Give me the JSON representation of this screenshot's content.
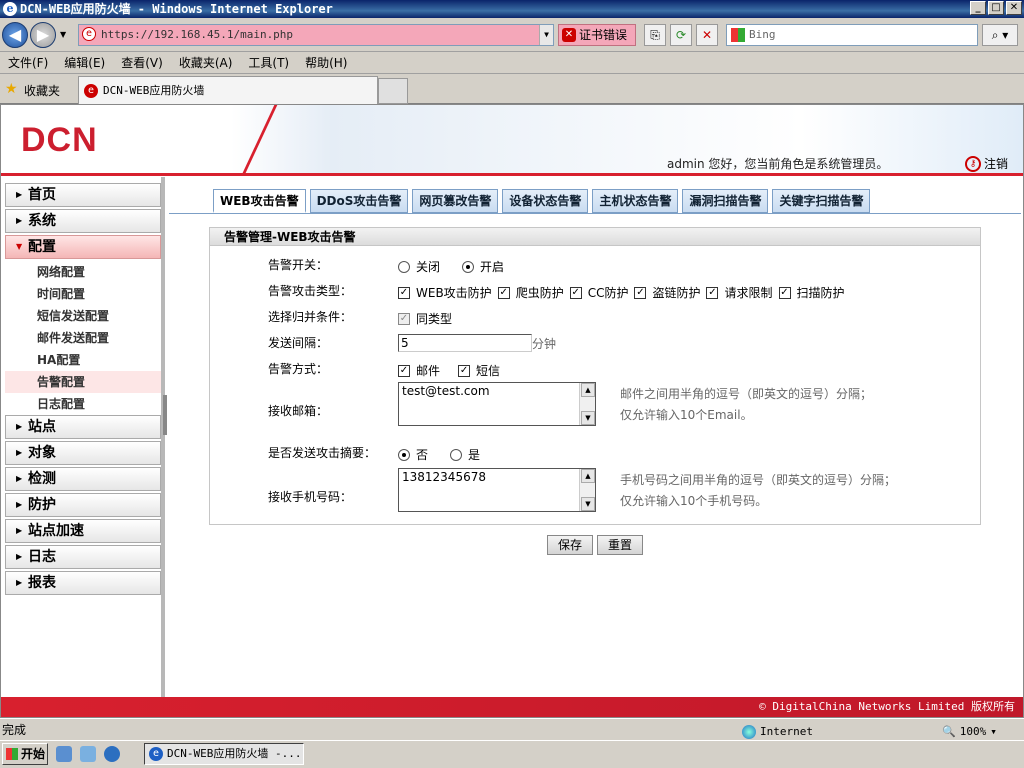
{
  "window": {
    "title": "DCN-WEB应用防火墙 - Windows Internet Explorer",
    "min": "_",
    "max": "□",
    "close": "✕"
  },
  "address": {
    "url": "https://192.168.45.1/main.php",
    "cert_error": "证书错误",
    "search_placeholder": "Bing"
  },
  "menu": [
    "文件(F)",
    "编辑(E)",
    "查看(V)",
    "收藏夹(A)",
    "工具(T)",
    "帮助(H)"
  ],
  "favorites": {
    "label": "收藏夹",
    "tab_title": "DCN-WEB应用防火墙"
  },
  "header": {
    "logo": "DCN",
    "welcome": "admin 您好，您当前角色是系统管理员。",
    "logout": "注销"
  },
  "sidebar": {
    "top": [
      {
        "label": "首页"
      },
      {
        "label": "系统"
      },
      {
        "label": "配置"
      }
    ],
    "sub": [
      "网络配置",
      "时间配置",
      "短信发送配置",
      "邮件发送配置",
      "HA配置",
      "告警配置",
      "日志配置"
    ],
    "bottom": [
      {
        "label": "站点"
      },
      {
        "label": "对象"
      },
      {
        "label": "检测"
      },
      {
        "label": "防护"
      },
      {
        "label": "站点加速"
      },
      {
        "label": "日志"
      },
      {
        "label": "报表"
      }
    ]
  },
  "tabs": [
    "WEB攻击告警",
    "DDoS攻击告警",
    "网页篡改告警",
    "设备状态告警",
    "主机状态告警",
    "漏洞扫描告警",
    "关键字扫描告警"
  ],
  "form": {
    "panel_title": "告警管理-WEB攻击告警",
    "switch_label": "告警开关：",
    "switch_off": "关闭",
    "switch_on": "开启",
    "attack_types_label": "告警攻击类型：",
    "attack_types": [
      "WEB攻击防护",
      "爬虫防护",
      "CC防护",
      "盗链防护",
      "请求限制",
      "扫描防护"
    ],
    "merge_label": "选择归并条件：",
    "merge_value": "同类型",
    "interval_label": "发送间隔：",
    "interval_value": "5",
    "interval_unit": "分钟",
    "method_label": "告警方式：",
    "method_email": "邮件",
    "method_sms": "短信",
    "email_label": "接收邮箱：",
    "email_value": "test@test.com",
    "email_hint1": "邮件之间用半角的逗号（即英文的逗号）分隔；",
    "email_hint2": "仅允许输入10个Email。",
    "summary_label": "是否发送攻击摘要：",
    "summary_no": "否",
    "summary_yes": "是",
    "phone_label": "接收手机号码：",
    "phone_value": "13812345678",
    "phone_hint1": "手机号码之间用半角的逗号（即英文的逗号）分隔；",
    "phone_hint2": "仅允许输入10个手机号码。",
    "save": "保存",
    "reset": "重置"
  },
  "footer": "© DigitalChina Networks Limited 版权所有",
  "status": {
    "text": "完成",
    "zone": "Internet",
    "zoom": "100%"
  },
  "taskbar": {
    "start": "开始",
    "task": "DCN-WEB应用防火墙 -..."
  }
}
